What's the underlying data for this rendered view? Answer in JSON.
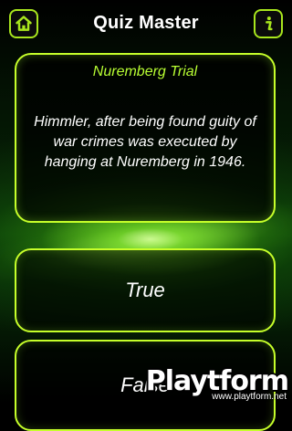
{
  "header": {
    "title": "Quiz Master",
    "home_icon": "home-icon",
    "info_icon": "info-icon",
    "accent_color": "#a8e61d"
  },
  "question": {
    "category": "Nuremberg Trial",
    "text": "Himmler, after being found guity of war crimes was executed by hanging at Nuremberg in 1946."
  },
  "answers": [
    {
      "label": "True"
    },
    {
      "label": "False"
    }
  ],
  "watermark": {
    "brand": "Playtform",
    "url": "www.playtform.net"
  }
}
